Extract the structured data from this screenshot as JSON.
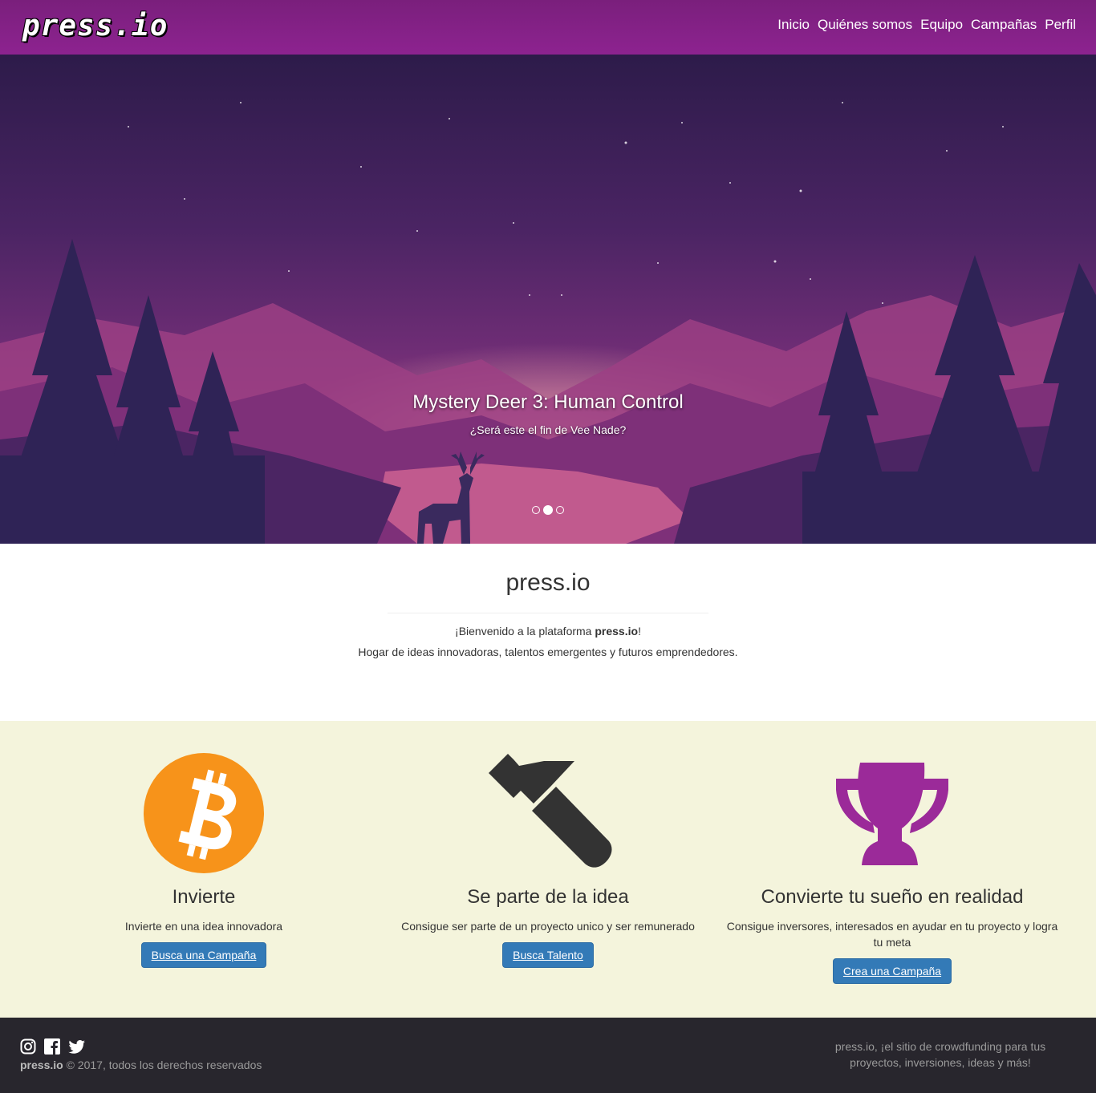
{
  "navbar": {
    "brand": "press.io",
    "links": [
      "Inicio",
      "Quiénes somos",
      "Equipo",
      "Campañas",
      "Perfil"
    ]
  },
  "carousel": {
    "title": "Mystery Deer 3: Human Control",
    "subtitle": "¿Será este el fin de Vee Nade?",
    "active_slide": 2,
    "slide_count": 3
  },
  "intro": {
    "heading": "press.io",
    "welcome_prefix": "¡Bienvenido a la plataforma ",
    "welcome_brand": "press.io",
    "welcome_suffix": "!",
    "tagline": "Hogar de ideas innovadoras, talentos emergentes y futuros emprendedores."
  },
  "features": [
    {
      "icon": "bitcoin-icon",
      "title": "Invierte",
      "text": "Invierte en una idea innovadora",
      "button": "Busca una Campaña",
      "color": "#f7931a"
    },
    {
      "icon": "hammer-icon",
      "title": "Se parte de la idea",
      "text": "Consigue ser parte de un proyecto unico y ser remunerado",
      "button": "Busca Talento",
      "color": "#333333"
    },
    {
      "icon": "trophy-icon",
      "title": "Convierte tu sueño en realidad",
      "text": "Consigue inversores, interesados en ayudar en tu proyecto y logra tu meta",
      "button": "Crea una Campaña",
      "color": "#9b2a99"
    }
  ],
  "footer": {
    "social": [
      "instagram-icon",
      "facebook-icon",
      "twitter-icon"
    ],
    "brand": "press.io",
    "copyright": " © 2017, todos los derechos reservados",
    "tagline": "press.io, ¡el sitio de crowdfunding para tus proyectos, inversiones, ideas y más!"
  },
  "colors": {
    "navbar": "#8d2390",
    "button": "#337ab7",
    "features_bg": "#f4f4dc",
    "footer_bg": "#28262d"
  }
}
